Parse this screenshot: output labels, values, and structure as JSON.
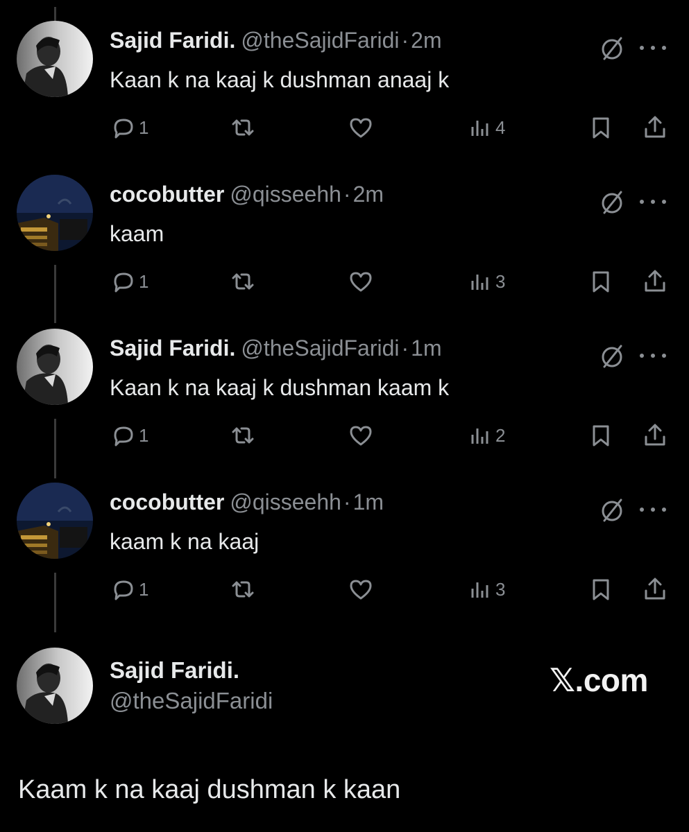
{
  "tweets": [
    {
      "name": "Sajid Faridi.",
      "handle": "@theSajidFaridi",
      "sep": "·",
      "time": "2m",
      "text": "Kaan k na kaaj k dushman anaaj k",
      "replies": "1",
      "views": "4",
      "avatar": "sajid"
    },
    {
      "name": "cocobutter",
      "handle": "@qisseehh",
      "sep": "·",
      "time": "2m",
      "text": "kaam",
      "replies": "1",
      "views": "3",
      "avatar": "coco"
    },
    {
      "name": "Sajid Faridi.",
      "handle": "@theSajidFaridi",
      "sep": "·",
      "time": "1m",
      "text": "Kaan k na kaaj k dushman kaam k",
      "replies": "1",
      "views": "2",
      "avatar": "sajid"
    },
    {
      "name": "cocobutter",
      "handle": "@qisseehh",
      "sep": "·",
      "time": "1m",
      "text": "kaam k na kaaj",
      "replies": "1",
      "views": "3",
      "avatar": "coco"
    }
  ],
  "profile": {
    "name": "Sajid Faridi.",
    "handle": "@theSajidFaridi",
    "brand": "𝕏.com"
  },
  "caption": "Kaam k na kaaj dushman k kaan",
  "icons": [
    "grok-icon",
    "more-icon",
    "reply-icon",
    "retweet-icon",
    "like-icon",
    "views-icon",
    "bookmark-icon",
    "share-icon"
  ],
  "colors": {
    "background": "#000000",
    "text": "#e7e9ea",
    "muted": "#8b8f94",
    "thread_line": "#3a3a3a"
  }
}
